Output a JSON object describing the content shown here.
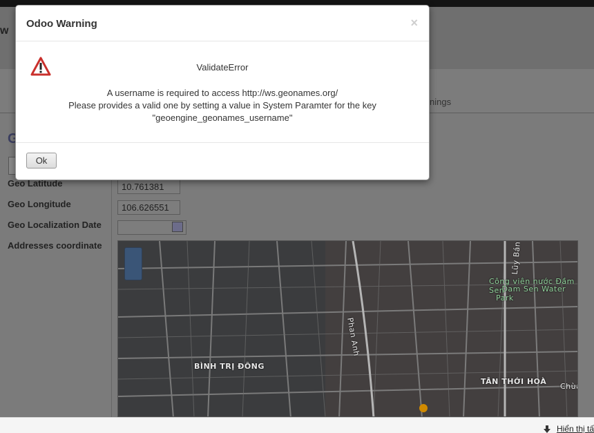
{
  "background": {
    "header_title_fragment": "w",
    "tab_fragment": "nings",
    "page_title_fragment": "G",
    "fields": [
      {
        "label": "Geo Latitude",
        "value": "10.761381"
      },
      {
        "label": "Geo Longitude",
        "value": "106.626551"
      },
      {
        "label": "Geo Localization Date",
        "value": ""
      },
      {
        "label": "Addresses coordinate",
        "value": ""
      }
    ],
    "map": {
      "labels": {
        "binh_tri_dong": "BÌNH TRỊ ĐÔNG",
        "tan_thoi_hoa": "TÂN THỚI HOÀ",
        "phan_anh": "Phan Anh",
        "luy_ban_bich": "Lũy Bán B",
        "park_line1": "Công viên nước Đầm Sen",
        "park_line2": "- Dam Sen Water Park",
        "chua": "Chùa"
      }
    }
  },
  "status_bar": {
    "link_text": "Hiển thị tấ"
  },
  "dialog": {
    "title": "Odoo Warning",
    "close_symbol": "×",
    "error_title": "ValidateError",
    "message_lines": [
      "A username is required to access http://ws.geonames.org/",
      "Please provides a valid one by setting a value in System Paramter for the key",
      "\"geoengine_geonames_username\""
    ],
    "ok_label": "Ok"
  },
  "colors": {
    "overlay": "#7a7a7a",
    "warning_red": "#c9302c",
    "title_blue": "#3c3f62"
  }
}
